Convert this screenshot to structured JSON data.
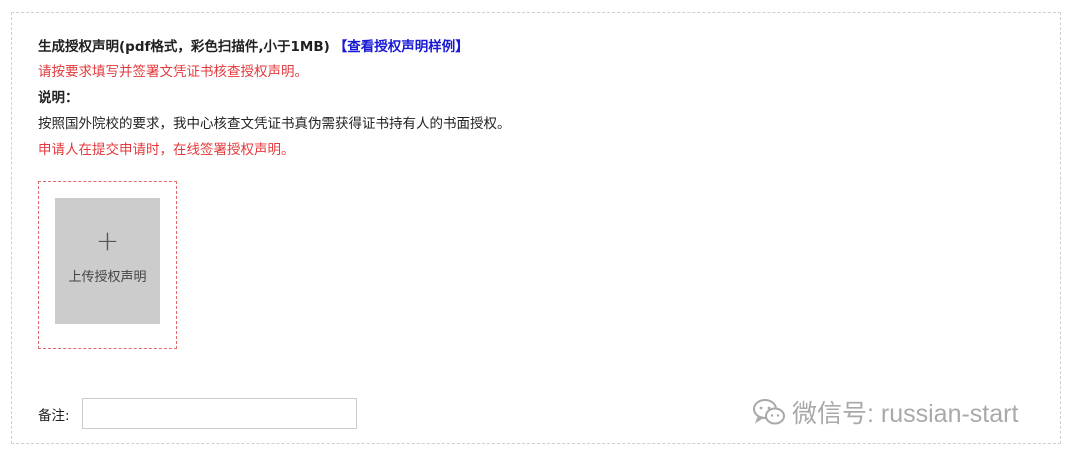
{
  "form": {
    "heading": "生成授权声明(pdf格式，彩色扫描件,小于1MB)",
    "sample_link": "【查看授权声明样例】",
    "requirement_note": "请按要求填写并签署文凭证书核查授权声明。",
    "description_label": "说明：",
    "description_text": "按照国外院校的要求，我中心核查文凭证书真伪需获得证书持有人的书面授权。",
    "applicant_note": "申请人在提交申请时，在线签署授权声明。"
  },
  "upload": {
    "plus": "+",
    "label": "上传授权声明"
  },
  "remark": {
    "label": "备注:",
    "value": "",
    "placeholder": ""
  },
  "watermark": {
    "icon": "wechat-icon",
    "text": "微信号: russian-start"
  },
  "colors": {
    "red_text": "#e4393c",
    "link": "#1a1ad6",
    "upload_bg": "#cccccc",
    "upload_border": "#e46b6b"
  }
}
